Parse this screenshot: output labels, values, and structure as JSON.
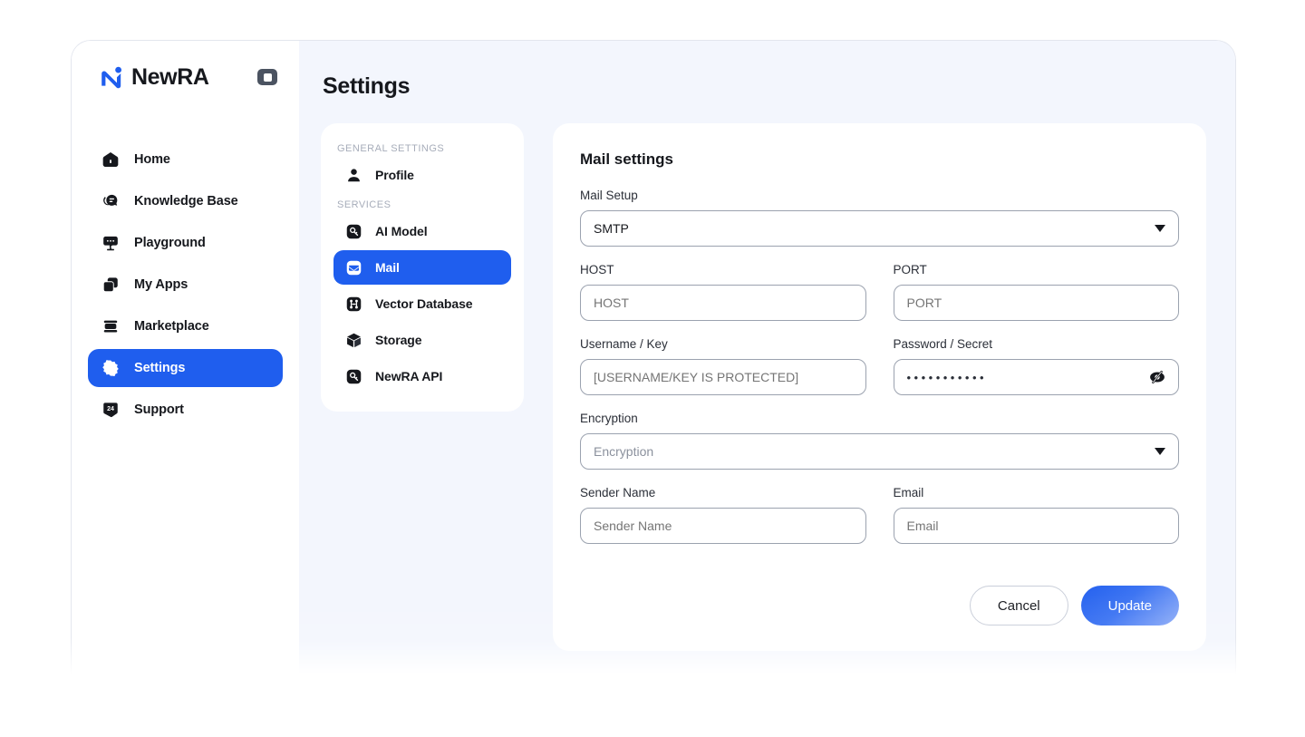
{
  "brand": {
    "name": "NewRA",
    "logo_icon": "newra-logo-icon",
    "collapse_icon": "sidebar-collapse-icon",
    "accent_color": "#1f5eee"
  },
  "sidebar": {
    "items": [
      {
        "label": "Home",
        "icon": "home-icon",
        "active": false
      },
      {
        "label": "Knowledge Base",
        "icon": "knowledge-base-icon",
        "active": false
      },
      {
        "label": "Playground",
        "icon": "playground-icon",
        "active": false
      },
      {
        "label": "My Apps",
        "icon": "my-apps-icon",
        "active": false
      },
      {
        "label": "Marketplace",
        "icon": "marketplace-icon",
        "active": false
      },
      {
        "label": "Settings",
        "icon": "gear-icon",
        "active": true
      },
      {
        "label": "Support",
        "icon": "support-24-icon",
        "active": false
      }
    ]
  },
  "header": {
    "title": "Settings"
  },
  "subnav": {
    "groups": [
      {
        "title": "GENERAL SETTINGS",
        "items": [
          {
            "label": "Profile",
            "icon": "person-icon",
            "active": false
          }
        ]
      },
      {
        "title": "SERVICES",
        "items": [
          {
            "label": "AI Model",
            "icon": "key-icon",
            "active": false
          },
          {
            "label": "Mail",
            "icon": "envelope-icon",
            "active": true
          },
          {
            "label": "Vector Database",
            "icon": "vector-database-icon",
            "active": false
          },
          {
            "label": "Storage",
            "icon": "cube-icon",
            "active": false
          },
          {
            "label": "NewRA API",
            "icon": "key-icon",
            "active": false
          }
        ]
      }
    ]
  },
  "form": {
    "title": "Mail settings",
    "mail_setup": {
      "label": "Mail Setup",
      "value": "SMTP",
      "is_placeholder": false,
      "caret_icon": "chevron-down-icon"
    },
    "host": {
      "label": "HOST",
      "value": "",
      "placeholder": "HOST"
    },
    "port": {
      "label": "PORT",
      "value": "",
      "placeholder": "PORT"
    },
    "username": {
      "label": "Username / Key",
      "value": "",
      "placeholder": "[USERNAME/KEY IS PROTECTED]"
    },
    "password": {
      "label": "Password / Secret",
      "value": "•••••••••••",
      "masked": true,
      "toggle_icon": "eye-slash-icon"
    },
    "encryption": {
      "label": "Encryption",
      "value": "",
      "placeholder": "Encryption",
      "is_placeholder": true,
      "caret_icon": "chevron-down-icon"
    },
    "sender_name": {
      "label": "Sender Name",
      "value": "",
      "placeholder": "Sender Name"
    },
    "email": {
      "label": "Email",
      "value": "",
      "placeholder": "Email"
    },
    "cancel_label": "Cancel",
    "update_label": "Update"
  }
}
